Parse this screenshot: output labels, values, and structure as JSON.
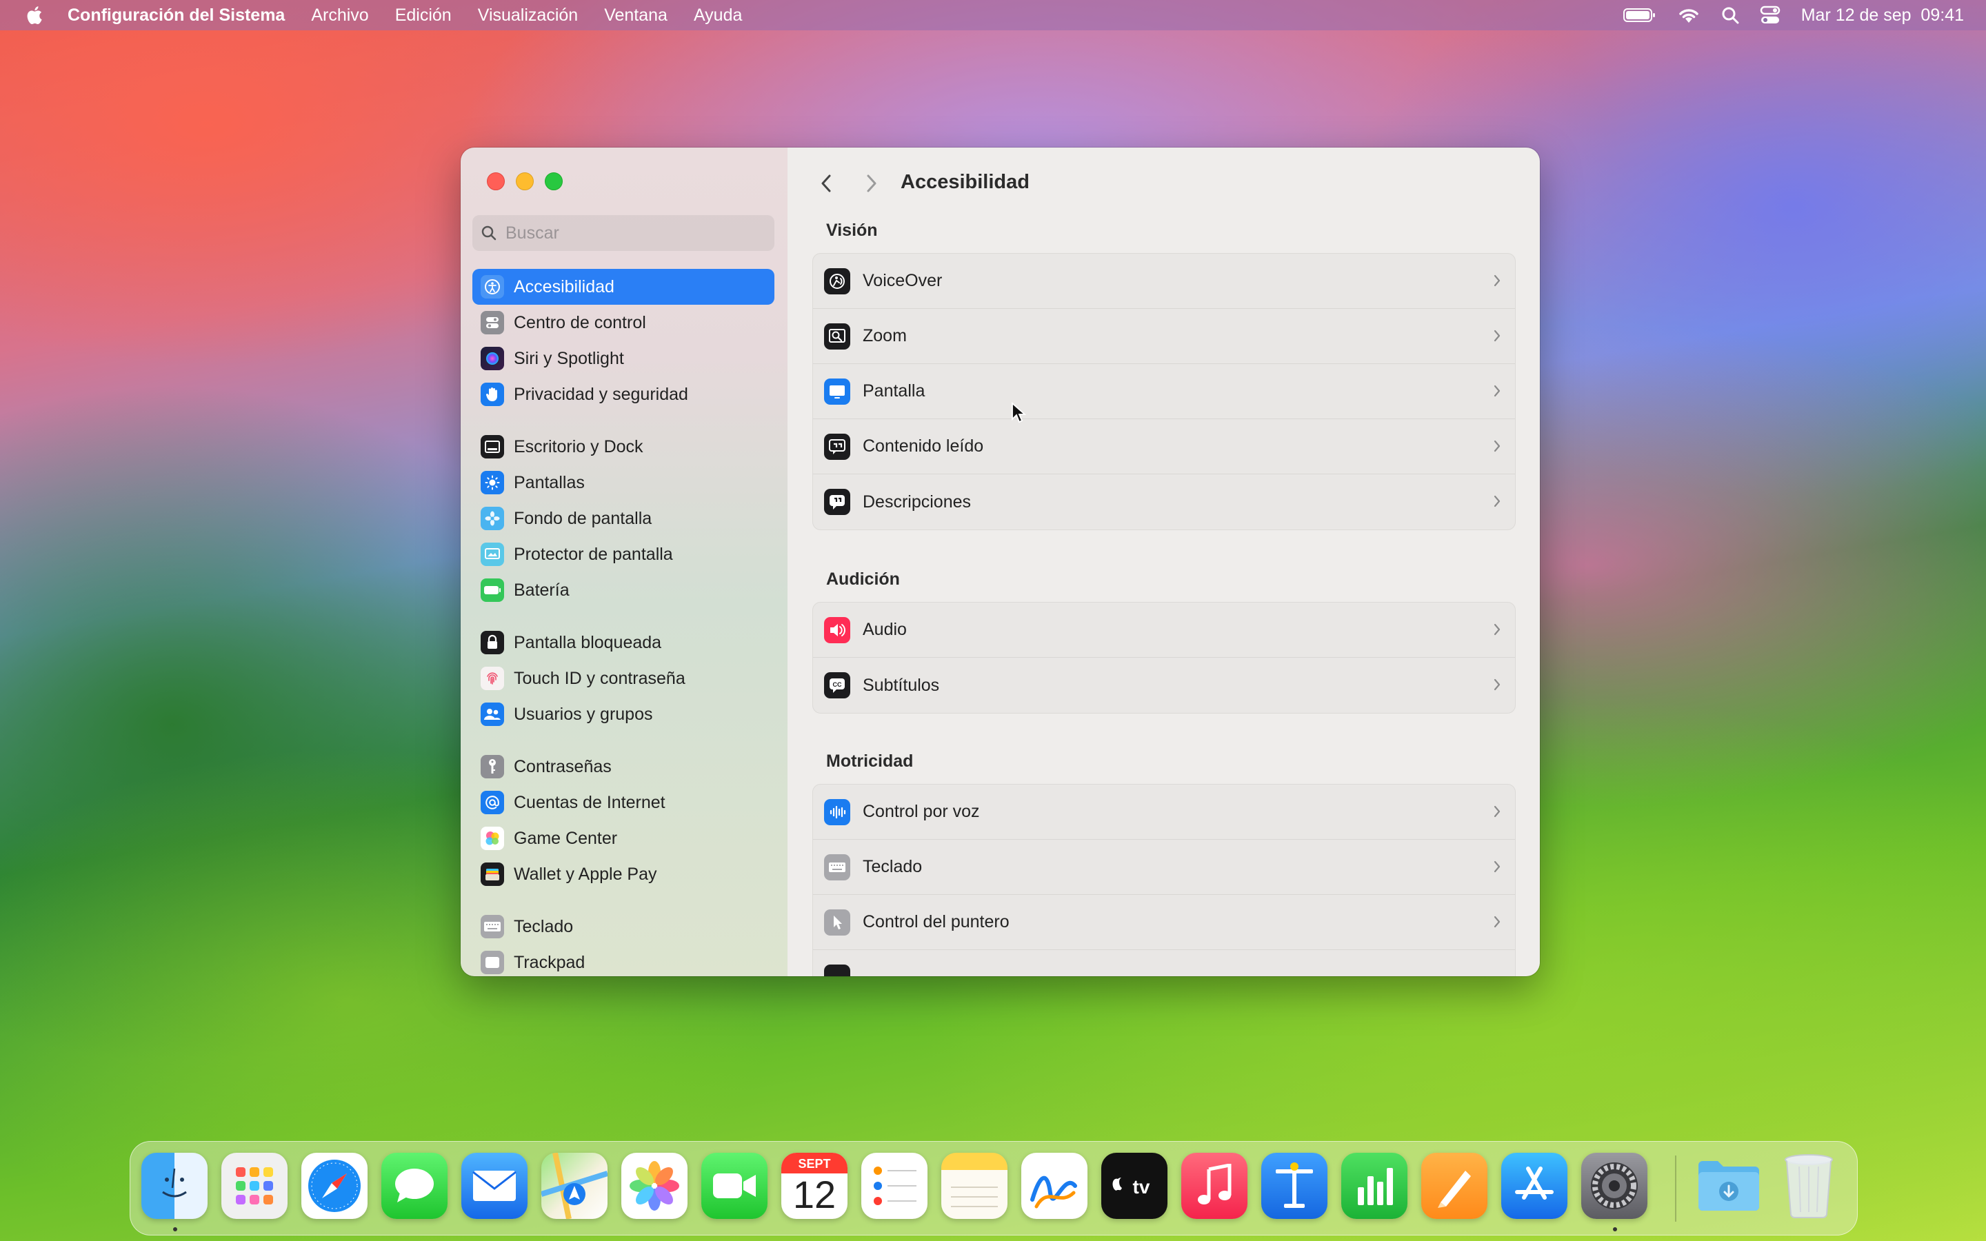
{
  "menubar": {
    "app_name": "Configuración del Sistema",
    "menus": [
      "Archivo",
      "Edición",
      "Visualización",
      "Ventana",
      "Ayuda"
    ],
    "datetime": "Mar 12 de sep  09:41"
  },
  "sidebar": {
    "search_placeholder": "Buscar",
    "items": [
      {
        "label": "Accesibilidad",
        "icon": "accessibility-icon",
        "color": "#1a7cf0",
        "selected": true
      },
      {
        "label": "Centro de control",
        "icon": "control-center-icon",
        "color": "#8e8e93"
      },
      {
        "label": "Siri y Spotlight",
        "icon": "siri-icon",
        "color": "#b03cc8"
      },
      {
        "label": "Privacidad y seguridad",
        "icon": "hand-icon",
        "color": "#1a7cf0"
      },
      {
        "label": "Escritorio y Dock",
        "icon": "dock-icon",
        "color": "#1c1c1e"
      },
      {
        "label": "Pantallas",
        "icon": "sun-icon",
        "color": "#1a7cf0"
      },
      {
        "label": "Fondo de pantalla",
        "icon": "flower-icon",
        "color": "#4ab4f0"
      },
      {
        "label": "Protector de pantalla",
        "icon": "screensaver-icon",
        "color": "#5ac8e8"
      },
      {
        "label": "Batería",
        "icon": "battery-icon",
        "color": "#34c759"
      },
      {
        "label": "Pantalla bloqueada",
        "icon": "lock-icon",
        "color": "#1c1c1e"
      },
      {
        "label": "Touch ID y contraseña",
        "icon": "fingerprint-icon",
        "color": "#f2f2f2"
      },
      {
        "label": "Usuarios y grupos",
        "icon": "users-icon",
        "color": "#1a7cf0"
      },
      {
        "label": "Contraseñas",
        "icon": "key-icon",
        "color": "#8e8e93"
      },
      {
        "label": "Cuentas de Internet",
        "icon": "at-icon",
        "color": "#1a7cf0"
      },
      {
        "label": "Game Center",
        "icon": "game-center-icon",
        "color": "#ffffff"
      },
      {
        "label": "Wallet y Apple Pay",
        "icon": "wallet-icon",
        "color": "#1c1c1e"
      },
      {
        "label": "Teclado",
        "icon": "keyboard-icon",
        "color": "#8e8e93"
      },
      {
        "label": "Trackpad",
        "icon": "trackpad-icon",
        "color": "#8e8e93"
      }
    ]
  },
  "content": {
    "title": "Accesibilidad",
    "sections": [
      {
        "label": "Visión",
        "rows": [
          {
            "label": "VoiceOver",
            "icon": "voiceover-icon"
          },
          {
            "label": "Zoom",
            "icon": "zoom-icon"
          },
          {
            "label": "Pantalla",
            "icon": "display-icon"
          },
          {
            "label": "Contenido leído",
            "icon": "spoken-content-icon"
          },
          {
            "label": "Descripciones",
            "icon": "descriptions-icon"
          }
        ]
      },
      {
        "label": "Audición",
        "rows": [
          {
            "label": "Audio",
            "icon": "speaker-icon"
          },
          {
            "label": "Subtítulos",
            "icon": "captions-icon"
          }
        ]
      },
      {
        "label": "Motricidad",
        "rows": [
          {
            "label": "Control por voz",
            "icon": "voice-control-icon"
          },
          {
            "label": "Teclado",
            "icon": "keyboard-icon"
          },
          {
            "label": "Control del puntero",
            "icon": "pointer-icon"
          }
        ]
      }
    ]
  },
  "dock": {
    "calendar_month": "SEPT",
    "calendar_day": "12",
    "apps": [
      "Finder",
      "Launchpad",
      "Safari",
      "Mensajes",
      "Mail",
      "Mapas",
      "Fotos",
      "FaceTime",
      "Calendario",
      "Recordatorios",
      "Notas",
      "Freeform",
      "TV",
      "Música",
      "Keynote",
      "Numbers",
      "Pages",
      "App Store",
      "Configuración del Sistema",
      "Descargas",
      "Papelera"
    ]
  }
}
